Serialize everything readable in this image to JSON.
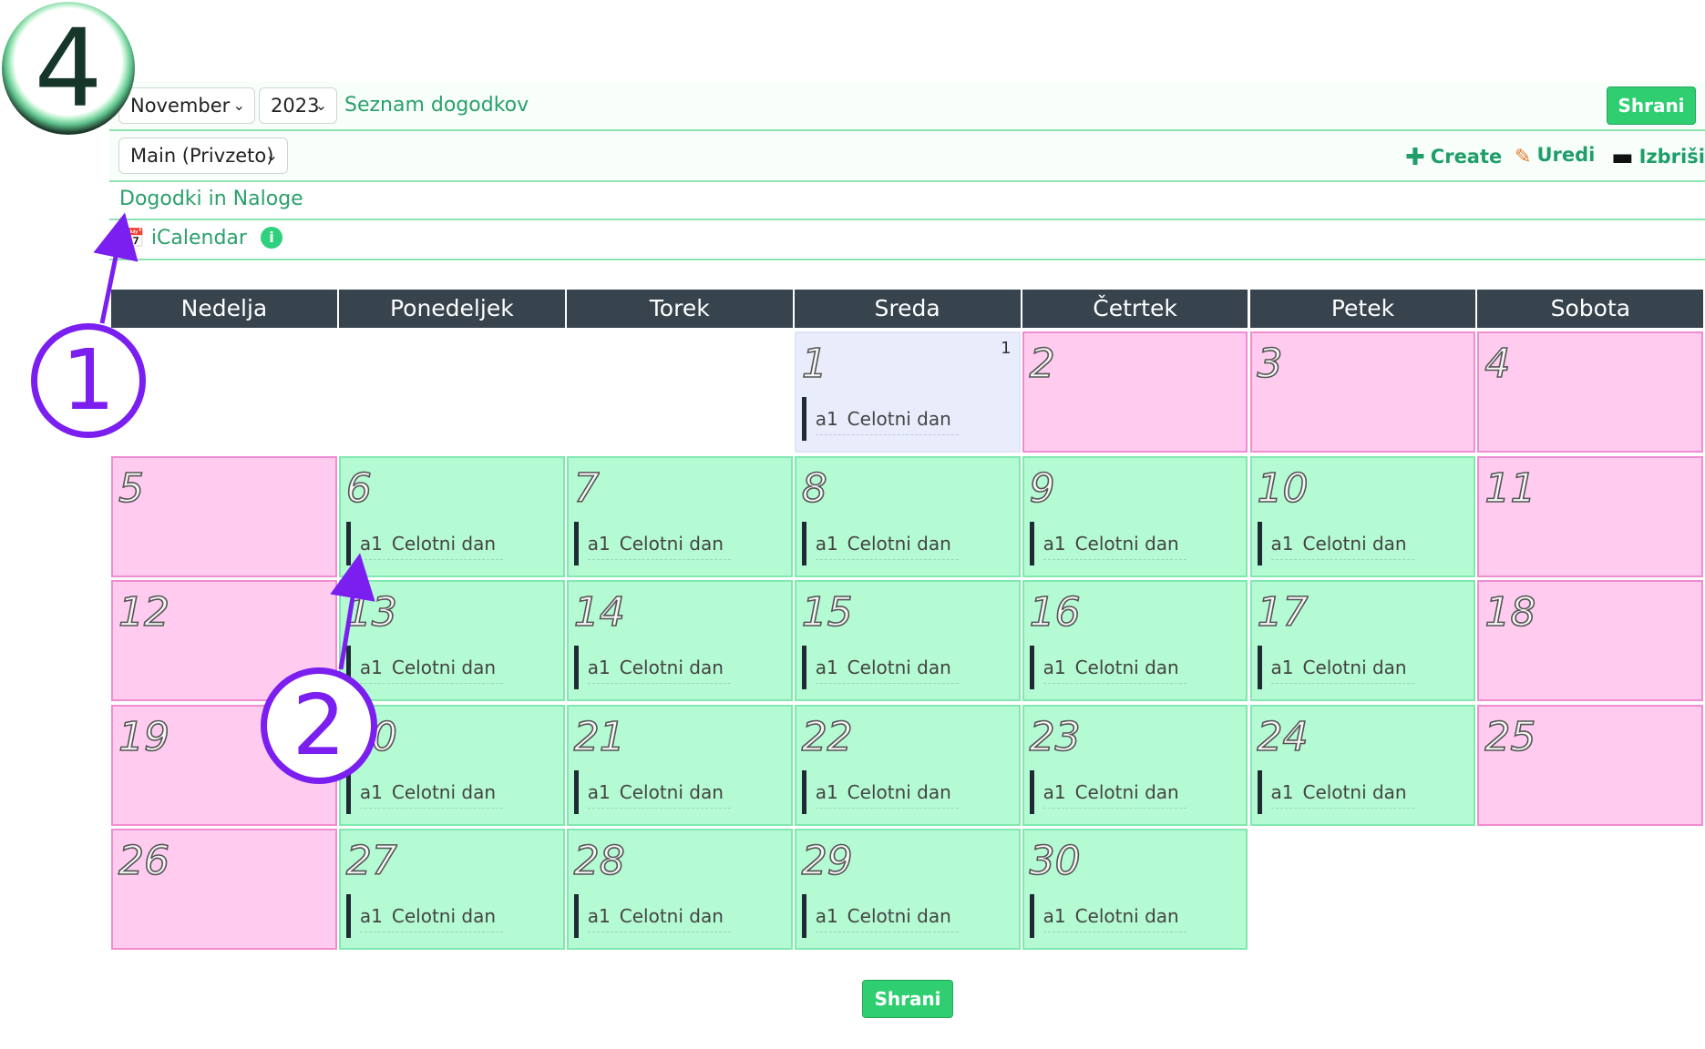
{
  "toolbar": {
    "month": "November",
    "year": "2023",
    "list_link": "Seznam dogodkov",
    "save_top": "Shrani",
    "calendar_select": "Main (Privzeto)",
    "create": "Create",
    "edit": "Uredi",
    "delete": "Izbriši"
  },
  "links": {
    "events_tasks": "Dogodki in Naloge",
    "icalendar": "iCalendar",
    "info": "i"
  },
  "calendar": {
    "weekdays": [
      "Nedelja",
      "Ponedeljek",
      "Torek",
      "Sreda",
      "Četrtek",
      "Petek",
      "Sobota"
    ],
    "event_label": "a1",
    "event_time": "Celotni dan",
    "today_count": "1",
    "days": [
      "1",
      "2",
      "3",
      "4",
      "5",
      "6",
      "7",
      "8",
      "9",
      "10",
      "11",
      "12",
      "13",
      "14",
      "15",
      "16",
      "17",
      "18",
      "19",
      "20",
      "21",
      "22",
      "23",
      "24",
      "25",
      "26",
      "27",
      "28",
      "29",
      "30"
    ]
  },
  "footer": {
    "save_bottom": "Shrani"
  },
  "annotations": {
    "badge_1": "1",
    "badge_2": "2",
    "badge_4": "4"
  },
  "colors": {
    "accent": "#2aa06a",
    "button": "#2fcf71",
    "weekend": "#ffccf0",
    "workday": "#b4fad2",
    "today": "#e9edfb",
    "header": "#37434d",
    "annotation": "#7a1ff0"
  }
}
